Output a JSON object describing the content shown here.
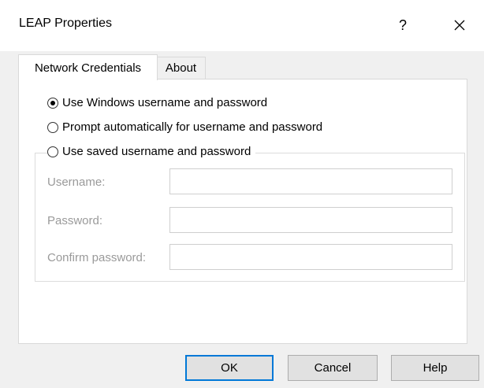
{
  "window": {
    "title": "LEAP Properties",
    "help_glyph": "?",
    "close_glyph": "close-icon"
  },
  "tabs": [
    {
      "label": "Network Credentials",
      "active": true
    },
    {
      "label": "About",
      "active": false
    }
  ],
  "options": {
    "use_windows": {
      "label": "Use Windows username and password",
      "checked": true
    },
    "prompt_auto": {
      "label": "Prompt automatically for username and password",
      "checked": false
    },
    "use_saved": {
      "label": "Use saved username and password",
      "checked": false
    }
  },
  "fields": {
    "username": {
      "label": "Username:",
      "value": ""
    },
    "password": {
      "label": "Password:",
      "value": ""
    },
    "confirm": {
      "label": "Confirm password:",
      "value": ""
    }
  },
  "buttons": {
    "ok": "OK",
    "cancel": "Cancel",
    "help": "Help"
  },
  "colors": {
    "accent": "#0078d7",
    "disabled_text": "#9a9a9a",
    "dialog_bg": "#f0f0f0"
  }
}
